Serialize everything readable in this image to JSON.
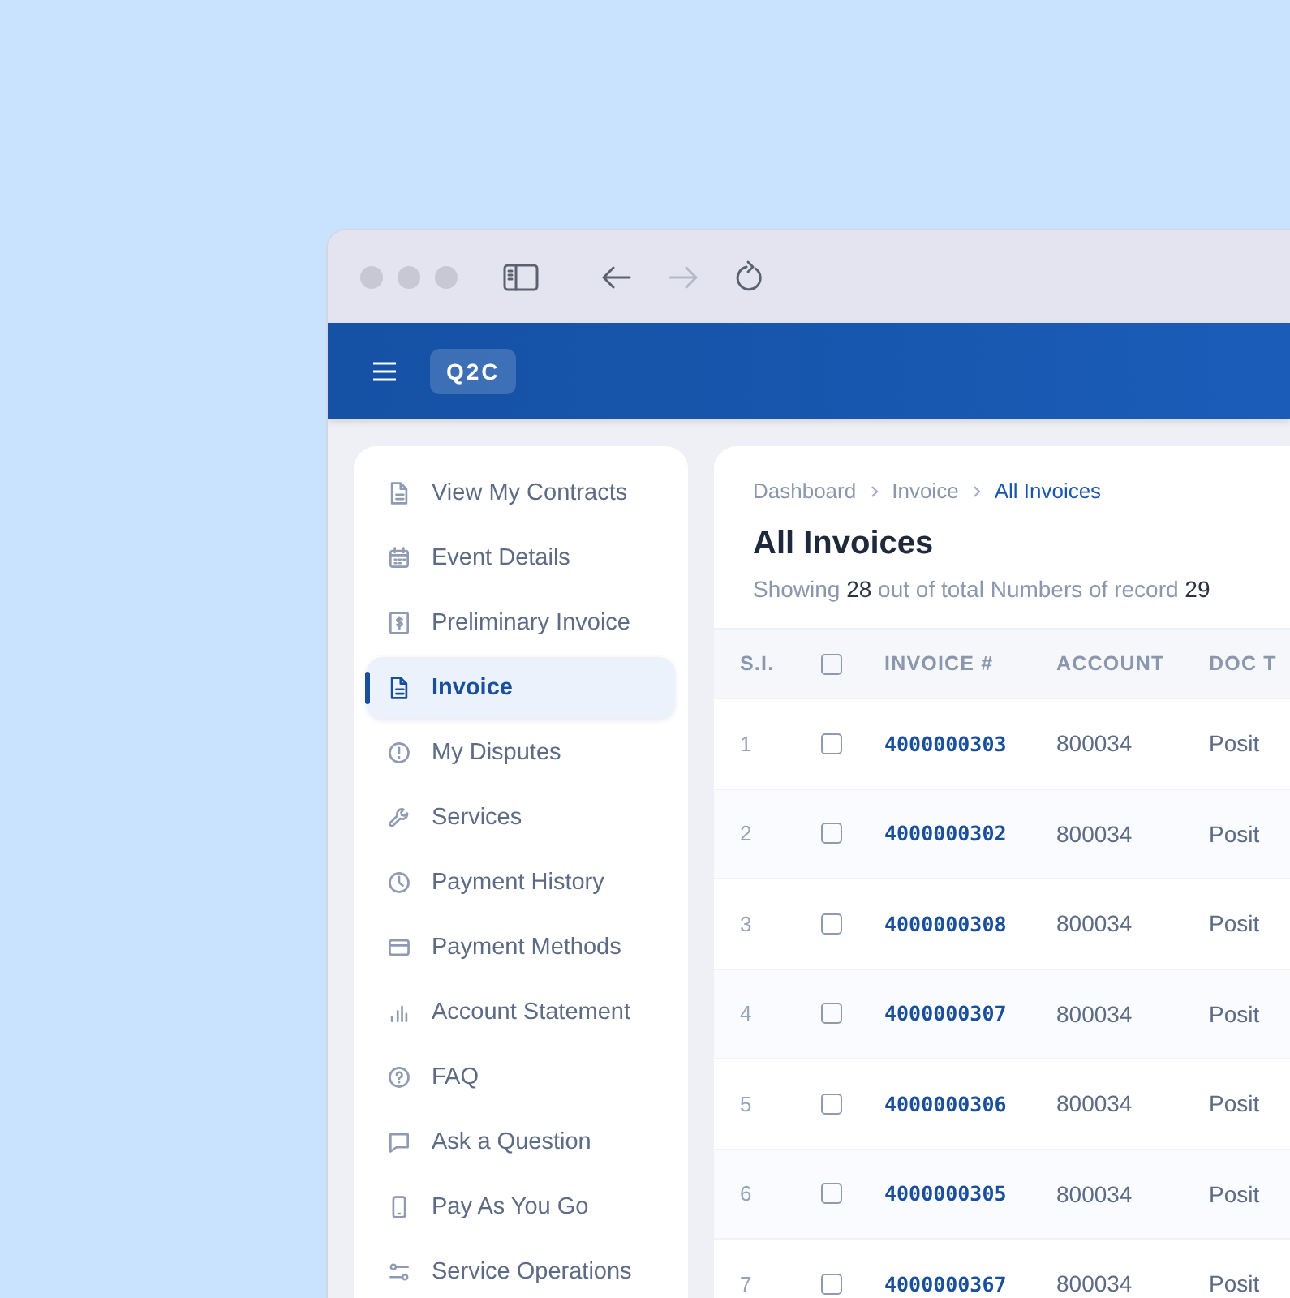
{
  "toolbar": {
    "back_disabled": false,
    "forward_disabled": true
  },
  "header": {
    "logo": "Q2C"
  },
  "sidebar": {
    "items": [
      {
        "label": "View My Contracts",
        "selected": false
      },
      {
        "label": "Event Details",
        "selected": false
      },
      {
        "label": "Preliminary Invoice",
        "selected": false
      },
      {
        "label": "Invoice",
        "selected": true
      },
      {
        "label": "My Disputes",
        "selected": false
      },
      {
        "label": "Services",
        "selected": false
      },
      {
        "label": "Payment History",
        "selected": false
      },
      {
        "label": "Payment Methods",
        "selected": false
      },
      {
        "label": "Account Statement",
        "selected": false
      },
      {
        "label": "FAQ",
        "selected": false
      },
      {
        "label": "Ask a Question",
        "selected": false
      },
      {
        "label": "Pay As You Go",
        "selected": false
      },
      {
        "label": "Service Operations",
        "selected": false
      }
    ]
  },
  "breadcrumb": [
    {
      "label": "Dashboard",
      "current": false
    },
    {
      "label": "Invoice",
      "current": false
    },
    {
      "label": "All Invoices",
      "current": true
    }
  ],
  "page_title": "All Invoices",
  "summary": "Showing **28** out of total Numbers of record **29**",
  "table": {
    "columns": [
      "S.I.",
      "INVOICE #",
      "ACCOUNT",
      "DOC T"
    ],
    "header_checked": false,
    "rows": [
      {
        "si": "1",
        "checked": false,
        "invoice": "4000000303",
        "account": "800034",
        "doc_type": "Posit"
      },
      {
        "si": "2",
        "checked": false,
        "invoice": "4000000302",
        "account": "800034",
        "doc_type": "Posit"
      },
      {
        "si": "3",
        "checked": false,
        "invoice": "4000000308",
        "account": "800034",
        "doc_type": "Posit"
      },
      {
        "si": "4",
        "checked": false,
        "invoice": "4000000307",
        "account": "800034",
        "doc_type": "Posit"
      },
      {
        "si": "5",
        "checked": false,
        "invoice": "4000000306",
        "account": "800034",
        "doc_type": "Posit"
      },
      {
        "si": "6",
        "checked": false,
        "invoice": "4000000305",
        "account": "800034",
        "doc_type": "Posit"
      },
      {
        "si": "7",
        "checked": false,
        "invoice": "4000000367",
        "account": "800034",
        "doc_type": "Posit"
      }
    ]
  }
}
